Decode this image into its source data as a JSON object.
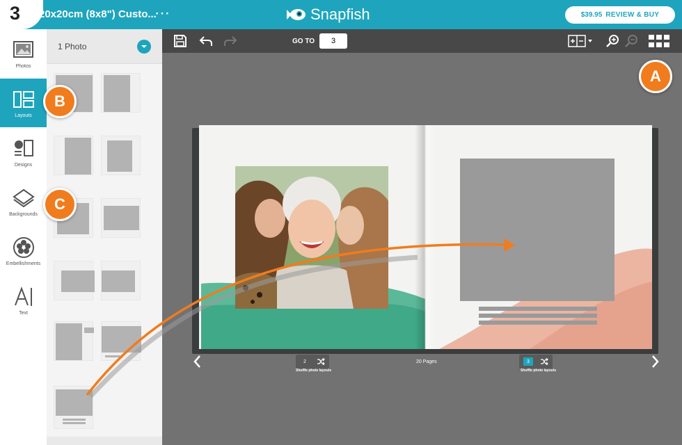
{
  "step": {
    "number": "3"
  },
  "header": {
    "product_title": "20x20cm (8x8\") Custo...",
    "more_label": "⋯",
    "logo_text": "Snapfish",
    "price": "$39.95",
    "review_label": "REVIEW & BUY"
  },
  "leftnav": {
    "items": [
      {
        "label": "Photos",
        "icon": "photos-icon"
      },
      {
        "label": "Layouts",
        "icon": "layouts-icon",
        "active": true
      },
      {
        "label": "Designs",
        "icon": "designs-icon"
      },
      {
        "label": "Backgrounds",
        "icon": "backgrounds-icon"
      },
      {
        "label": "Embellishments",
        "icon": "embellishments-icon"
      },
      {
        "label": "Text",
        "icon": "text-icon"
      }
    ]
  },
  "panel": {
    "filter_label": "1 Photo"
  },
  "toolbar": {
    "goto_label": "GO TO",
    "goto_value": "3"
  },
  "book": {
    "pages_label": "20 Pages",
    "left_page_number": "2",
    "right_page_number": "3",
    "shuffle_label": "Shuffle photo layouts"
  },
  "callouts": {
    "a": "A",
    "b": "B",
    "c": "C"
  },
  "colors": {
    "brand": "#1ea5bd",
    "callout": "#f07c1e",
    "green_wash": "#3fae8a",
    "peach_wash": "#e8a58e"
  }
}
